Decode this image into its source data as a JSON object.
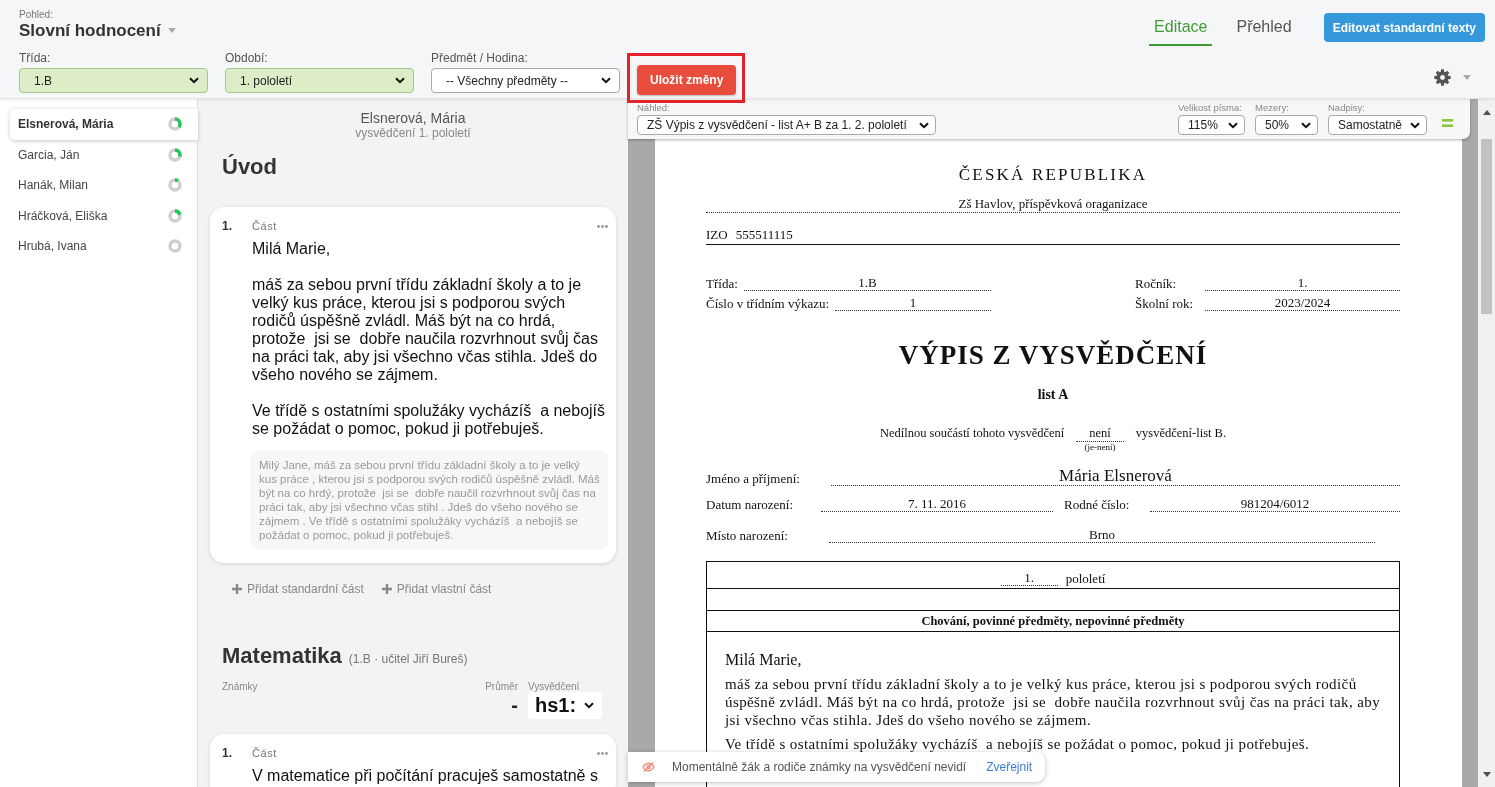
{
  "view": {
    "label": "Pohled:",
    "title": "Slovní hodnocení"
  },
  "filters": [
    {
      "label": "Třída:",
      "value": "1.B",
      "highlighted": true
    },
    {
      "label": "Období:",
      "value": "1. pololetí",
      "highlighted": true
    },
    {
      "label": "Předmět / Hodina:",
      "value": "-- Všechny předměty --",
      "highlighted": false
    }
  ],
  "save_button": {
    "label": "Uložit změny",
    "annotated": true
  },
  "tabs": [
    {
      "label": "Editace",
      "selected": true
    },
    {
      "label": "Přehled",
      "selected": false
    }
  ],
  "standard_texts_button": {
    "label": "Editovat standardní texty"
  },
  "students": [
    {
      "name": "Elsnerová, Mária",
      "selected": true,
      "level": 0.35
    },
    {
      "name": "Garcia, Ján",
      "selected": false,
      "level": 0.3
    },
    {
      "name": "Hanák, Milan",
      "selected": false,
      "level": 0.1
    },
    {
      "name": "Hráčková, Eliška",
      "selected": false,
      "level": 0.2
    },
    {
      "name": "Hrubá, Ivana",
      "selected": false,
      "level": 0
    }
  ],
  "editor": {
    "student_name": "Elsnerová, Mária",
    "subtitle": "vysvědčení 1. pololetí",
    "sections": [
      {
        "title": "Úvod",
        "parts": [
          {
            "number": "1.",
            "label": "Část",
            "paragraphs": [
              "Milá Marie,",
              "máš za sebou první třídu základní školy a to je velký kus práce, kterou jsi s podporou svých rodičů úspěšně zvládl. Máš být na co hrdá, protože  jsi se  dobře naučila rozvrhnout svůj čas na práci tak, aby jsi všechno včas stihla. Jdeš do všeho nového se zájmem.",
              "Ve třídě s ostatními spolužáky vycházíš  a nebojíš se požádat o pomoc, pokud ji potřebuješ."
            ],
            "suggestion": "Milý Jane, máš za sebou první třídu základní školy a to je velký kus práce , kterou jsi s podporou svých rodičů úspěšně zvládl. Máš být na co hrdý, protože  jsi se  dobře naučil rozvrhnout svůj čas na práci tak, aby jsi všechno včas stihl . Jdeš do všeho nového se zájmem . Ve třídě s ostatními spolužáky vycházíš  a nebojíš se požádat o pomoc, pokud ji potřebuješ."
          }
        ],
        "add_actions": [
          "Přidat standardní část",
          "Přidat vlastní část"
        ]
      },
      {
        "title": "Matematika",
        "meta": "(1.B · učitel Jiří Bureš)",
        "grades": {
          "label": "Známky",
          "average_label": "Průměr",
          "average": "-",
          "certificate_label": "Vysvědčení",
          "certificate_value": "hs1:"
        },
        "parts": [
          {
            "number": "1.",
            "label": "Část",
            "paragraphs": [
              "V matematice při počítání pracuješ samostatně s"
            ]
          }
        ]
      }
    ]
  },
  "preview": {
    "toolbar": {
      "template": {
        "label": "Náhled:",
        "value": "ZŠ Výpis z vysvědčení - list A+ B za 1. 2. pololetí"
      },
      "options": [
        {
          "label": "Velikost písma:",
          "value": "115%"
        },
        {
          "label": "Mezery:",
          "value": "50%"
        },
        {
          "label": "Nadpisy:",
          "value": "Samostatně"
        }
      ]
    },
    "document": {
      "country": "ČESKÁ REPUBLIKA",
      "school": "Zš Havlov, příspěvková oraganizace",
      "izo": {
        "label": "IZO",
        "value": "555511115"
      },
      "info_rows": [
        [
          {
            "label": "Třída:",
            "value": "1.B"
          },
          {
            "label": "Ročník:",
            "value": "1."
          }
        ],
        [
          {
            "label": "Číslo v třídním výkazu:",
            "value": "1"
          },
          {
            "label": "Školní rok:",
            "value": "2023/2024"
          }
        ]
      ],
      "title": "VÝPIS Z VYSVĚDČENÍ",
      "sheet": "list A",
      "attachment": {
        "before": "Nedílnou součástí tohoto vysvědčení",
        "value": "není",
        "hint": "(je-není)",
        "after": "vysvědčení-list B."
      },
      "full_name": {
        "label": "Jméno a příjmení:",
        "value": "Mária Elsnerová"
      },
      "birth": [
        {
          "label": "Datum narození:",
          "value": "7. 11. 2016"
        },
        {
          "label": "Rodné číslo:",
          "value": "981204/6012"
        }
      ],
      "birthplace": {
        "label": "Místo narození:",
        "value": "Brno"
      },
      "period": {
        "value": "1.",
        "label": "pololetí"
      },
      "subjects_heading": "Chování, povinné předměty, nepovinné předměty",
      "greeting": "Milá Marie,",
      "paragraphs": [
        "máš za sebou první třídu základní školy a to je velký kus práce, kterou jsi s podporou svých rodičů úspěšně zvládl. Máš být na co hrdá, protože  jsi se  dobře naučila rozvrhnout svůj čas na práci tak, aby jsi všechno včas stihla. Jdeš do všeho nového se zájmem.",
        "Ve třídě s ostatními spolužáky vycházíš  a nebojíš se požádat o pomoc, pokud ji potřebuješ."
      ]
    }
  },
  "notice": {
    "text": "Momentálně žák a rodiče známky na vysvědčení nevidí",
    "action": "Zveřejnit"
  }
}
